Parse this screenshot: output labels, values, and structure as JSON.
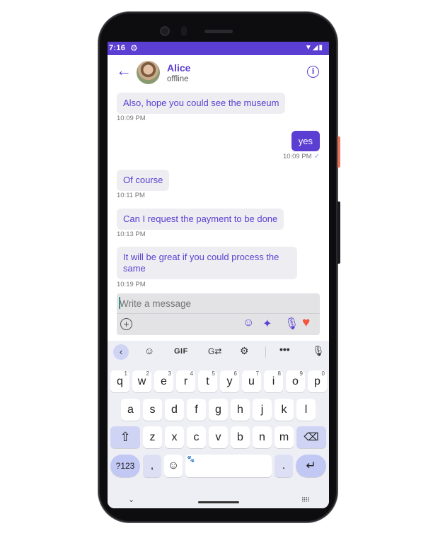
{
  "status_bar": {
    "time": "7:16",
    "settings_icon": "gear-icon",
    "right_icons": [
      "wifi-icon",
      "signal-icon",
      "battery-icon"
    ]
  },
  "header": {
    "back_icon": "arrow-left-icon",
    "name": "Alice",
    "status": "offline",
    "info_icon": "info-icon"
  },
  "messages": [
    {
      "direction": "in",
      "text": "Also, hope you could see the museum",
      "time": "10:09 PM"
    },
    {
      "direction": "out",
      "text": "yes",
      "time": "10:09 PM",
      "read_icon": "check-icon"
    },
    {
      "direction": "in",
      "text": "Of course",
      "time": "10:11 PM"
    },
    {
      "direction": "in",
      "text": "Can I request the payment to be done",
      "time": "10:13 PM"
    },
    {
      "direction": "in",
      "text": "It will be great if you could process the same",
      "time": "10:19 PM"
    }
  ],
  "composer": {
    "placeholder": "Write a message",
    "icons": [
      "plus-circle-icon",
      "sticker-icon",
      "sparkle-icon",
      "microphone-icon",
      "heart-icon"
    ],
    "accent": "#f4533e"
  },
  "keyboard": {
    "toolbar": {
      "gif": "GIF"
    },
    "row1": [
      {
        "k": "q",
        "n": "1"
      },
      {
        "k": "w",
        "n": "2"
      },
      {
        "k": "e",
        "n": "3"
      },
      {
        "k": "r",
        "n": "4"
      },
      {
        "k": "t",
        "n": "5"
      },
      {
        "k": "y",
        "n": "6"
      },
      {
        "k": "u",
        "n": "7"
      },
      {
        "k": "i",
        "n": "8"
      },
      {
        "k": "o",
        "n": "9"
      },
      {
        "k": "p",
        "n": "0"
      }
    ],
    "row2": [
      "a",
      "s",
      "d",
      "f",
      "g",
      "h",
      "j",
      "k",
      "l"
    ],
    "row3": [
      "z",
      "x",
      "c",
      "v",
      "b",
      "n",
      "m"
    ],
    "bottom": {
      "sym": "?123",
      "comma": ",",
      "period": "."
    }
  },
  "colors": {
    "primary": "#5b3fd2",
    "bubble_in": "#eeeef2"
  }
}
